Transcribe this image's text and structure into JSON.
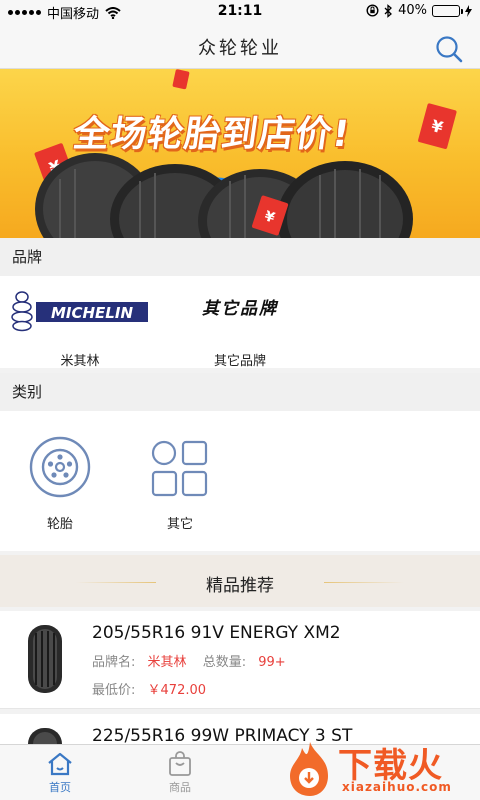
{
  "status_bar": {
    "carrier": "中国移动",
    "time": "21:11",
    "battery": "40%",
    "battery_level": 0.4
  },
  "header": {
    "title": "众轮轮业",
    "search_icon": "search-icon"
  },
  "banner": {
    "headline": "全场轮胎到店价!",
    "slide_count": 3,
    "active_slide": 1
  },
  "brands": {
    "section_title": "品牌",
    "items": [
      {
        "label": "米其林",
        "logo_text": "MICHELIN"
      },
      {
        "label": "其它品牌",
        "logo_text": "其它品牌"
      }
    ]
  },
  "categories": {
    "section_title": "类别",
    "items": [
      {
        "label": "轮胎",
        "icon": "tire-icon"
      },
      {
        "label": "其它",
        "icon": "grid-icon"
      }
    ]
  },
  "recommend": {
    "title": "精品推荐",
    "products": [
      {
        "name": "205/55R16 91V ENERGY XM2",
        "brand_label": "品牌名:",
        "brand": "米其林",
        "qty_label": "总数量:",
        "qty": "99+",
        "price_label": "最低价:",
        "price": "￥472.00"
      },
      {
        "name": "225/55R16 99W PRIMACY 3 ST"
      }
    ]
  },
  "tabbar": {
    "items": [
      {
        "label": "首页",
        "icon": "home-icon",
        "active": true
      },
      {
        "label": "商品",
        "icon": "bag-icon",
        "active": false
      }
    ]
  },
  "watermark": {
    "title": "下载火",
    "url": "xiazaihuo.com"
  },
  "colors": {
    "accent": "#3a78c4",
    "price_red": "#e8403c",
    "banner_yellow": "#f9bd2c"
  }
}
